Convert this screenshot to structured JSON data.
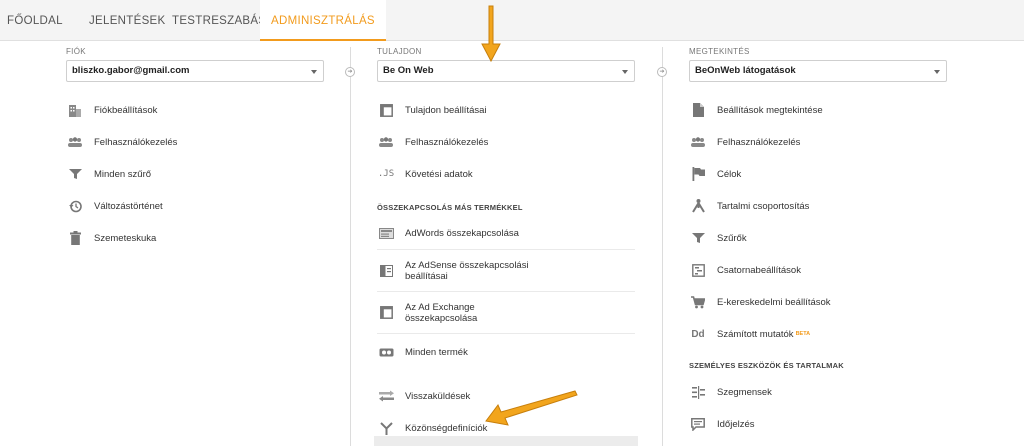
{
  "nav": {
    "tabs": [
      {
        "label": "FŐOLDAL"
      },
      {
        "label": "JELENTÉSEK"
      },
      {
        "label": "TESTRESZABÁS"
      },
      {
        "label": "ADMINISZTRÁLÁS"
      }
    ],
    "active_tab": "ADMINISZTRÁLÁS"
  },
  "account": {
    "label": "FIÓK",
    "selected": "bliszko.gabor@gmail.com",
    "items": [
      {
        "label": "Fiókbeállítások",
        "icon": "building-icon"
      },
      {
        "label": "Felhasználókezelés",
        "icon": "users-icon"
      },
      {
        "label": "Minden szűrő",
        "icon": "filter-icon"
      },
      {
        "label": "Változástörténet",
        "icon": "history-icon"
      },
      {
        "label": "Szemeteskuka",
        "icon": "trash-icon"
      }
    ]
  },
  "property": {
    "label": "TULAJDON",
    "selected": "Be On Web",
    "items": [
      {
        "label": "Tulajdon beállításai",
        "icon": "window-icon"
      },
      {
        "label": "Felhasználókezelés",
        "icon": "users-icon"
      },
      {
        "label": "Követési adatok",
        "icon": "js-icon"
      }
    ],
    "section_title": "ÖSSZEKAPCSOLÁS MÁS TERMÉKKEL",
    "link_items": [
      {
        "label": "AdWords összekapcsolása",
        "icon": "adwords-icon"
      },
      {
        "label": "Az AdSense összekapcsolási beállításai",
        "icon": "adsense-icon"
      },
      {
        "label": "Az Ad Exchange összekapcsolása",
        "icon": "adexchange-icon"
      },
      {
        "label": "Minden termék",
        "icon": "link-icon"
      }
    ],
    "more_items": [
      {
        "label": "Visszaküldések",
        "icon": "postback-icon"
      },
      {
        "label": "Közönségdefiníciók",
        "icon": "audience-icon"
      }
    ]
  },
  "view": {
    "label": "MEGTEKINTÉS",
    "selected": "BeOnWeb látogatások",
    "items": [
      {
        "label": "Beállítások megtekintése",
        "icon": "document-icon"
      },
      {
        "label": "Felhasználókezelés",
        "icon": "users-icon"
      },
      {
        "label": "Célok",
        "icon": "flag-icon"
      },
      {
        "label": "Tartalmi csoportosítás",
        "icon": "grouping-icon"
      },
      {
        "label": "Szűrők",
        "icon": "filter-icon"
      },
      {
        "label": "Csatornabeállítások",
        "icon": "channel-icon"
      },
      {
        "label": "E-kereskedelmi beállítások",
        "icon": "cart-icon"
      },
      {
        "label": "Számított mutatók",
        "icon": "dd-icon",
        "badge": "BETA"
      }
    ],
    "section_title": "SZEMÉLYES ESZKÖZÖK ÉS TARTALMAK",
    "personal_items": [
      {
        "label": "Szegmensek",
        "icon": "segments-icon"
      },
      {
        "label": "Időjelzés",
        "icon": "annotation-icon"
      }
    ]
  },
  "colors": {
    "accent": "#f29b1d",
    "arrow": "#f2a51d"
  }
}
